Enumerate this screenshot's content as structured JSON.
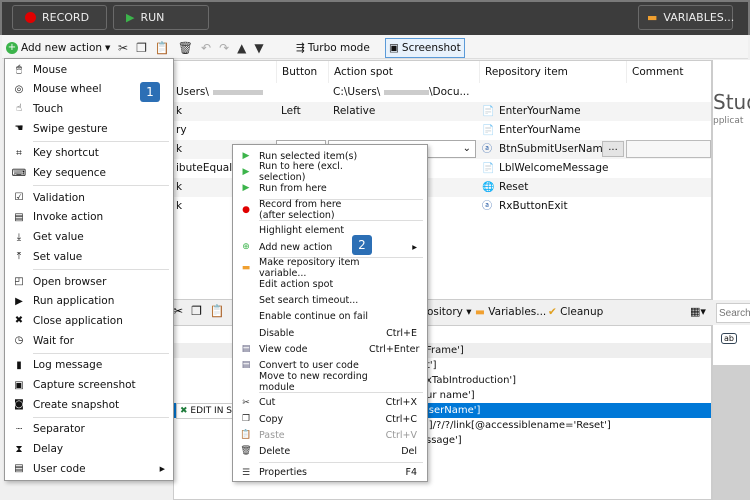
{
  "topbar": {
    "record": "RECORD",
    "run": "RUN",
    "variables": "VARIABLES..."
  },
  "toolbar": {
    "add_new_action": "Add new action",
    "turbo_mode": "Turbo mode",
    "screenshot": "Screenshot"
  },
  "grid": {
    "headers": [
      "",
      "Button",
      "Action spot",
      "Repository item",
      "Comment"
    ],
    "rows": [
      {
        "c0": "Users\\",
        "button": "",
        "spot": "C:\\Users\\",
        "spot2": "\\Docu...",
        "repo": "",
        "icon": ""
      },
      {
        "c0": "k",
        "button": "Left",
        "spot": "Relative",
        "repo": "EnterYourName",
        "icon": "doc"
      },
      {
        "c0": "ry",
        "button": "",
        "spot": "",
        "repo": "EnterYourName",
        "icon": "doc"
      },
      {
        "c0": "k",
        "button": "",
        "spot": "",
        "repo": "BtnSubmitUserName",
        "icon": "ab"
      },
      {
        "c0": "ibuteEqual",
        "button": "",
        "spot": "",
        "repo": "LblWelcomeMessage",
        "icon": "doc"
      },
      {
        "c0": "k",
        "button": "",
        "spot": "",
        "repo": "Reset",
        "icon": "globe"
      },
      {
        "c0": "k",
        "button": "",
        "spot": "",
        "repo": "RxButtonExit",
        "icon": "ab"
      }
    ],
    "browse": "..."
  },
  "side_panel": {
    "title": "Stud",
    "subtitle": "pplicat"
  },
  "bottom_toolbar": {
    "repository": "ository",
    "variables": "Variables...",
    "cleanup": "Cleanup",
    "search_placeholder": "Search"
  },
  "bottom_grid": {
    "edit_button": "EDIT IN S",
    "rows": [
      "Frame']",
      "t']",
      "xTabIntroduction']",
      "ur name']",
      "lserName']",
      "']/?/?/link[@accessiblename='Reset']",
      "ssage']"
    ],
    "selected_index": 4
  },
  "add_menu": {
    "badge": "1",
    "groups": [
      [
        "Mouse",
        "Mouse wheel",
        "Touch",
        "Swipe gesture"
      ],
      [
        "Key shortcut",
        "Key sequence"
      ],
      [
        "Validation",
        "Invoke action",
        "Get value",
        "Set value"
      ],
      [
        "Open browser",
        "Run application",
        "Close application",
        "Wait for"
      ],
      [
        "Log message",
        "Capture screenshot",
        "Create snapshot"
      ],
      [
        "Separator",
        "Delay",
        "User code"
      ]
    ]
  },
  "context_menu": {
    "badge": "2",
    "items": [
      {
        "label": "Run selected item(s)",
        "shortcut": "",
        "icon": "run"
      },
      {
        "label": "Run to here (excl. selection)",
        "shortcut": "",
        "icon": "run"
      },
      {
        "label": "Run from here",
        "shortcut": "",
        "icon": "run"
      },
      {
        "sep": true
      },
      {
        "label": "Record from here (after selection)",
        "shortcut": "",
        "icon": "record"
      },
      {
        "sep": true
      },
      {
        "label": "Highlight element",
        "shortcut": "",
        "icon": ""
      },
      {
        "label": "Add new action",
        "shortcut": "",
        "icon": "add",
        "submenu": true
      },
      {
        "sep": true
      },
      {
        "label": "Make repository item variable...",
        "shortcut": "",
        "icon": "var"
      },
      {
        "label": "Edit action spot",
        "shortcut": "",
        "icon": ""
      },
      {
        "label": "Set search timeout...",
        "shortcut": "",
        "icon": ""
      },
      {
        "label": "Enable continue on fail",
        "shortcut": "",
        "icon": ""
      },
      {
        "label": "Disable",
        "shortcut": "Ctrl+E",
        "icon": ""
      },
      {
        "label": "View code",
        "shortcut": "Ctrl+Enter",
        "icon": "code"
      },
      {
        "label": "Convert to user code",
        "shortcut": "",
        "icon": "code"
      },
      {
        "label": "Move to new recording module",
        "shortcut": "",
        "icon": ""
      },
      {
        "sep": true
      },
      {
        "label": "Cut",
        "shortcut": "Ctrl+X",
        "icon": "cut"
      },
      {
        "label": "Copy",
        "shortcut": "Ctrl+C",
        "icon": "copy"
      },
      {
        "label": "Paste",
        "shortcut": "Ctrl+V",
        "icon": "paste",
        "disabled": true
      },
      {
        "label": "Delete",
        "shortcut": "Del",
        "icon": "delete"
      },
      {
        "sep": true
      },
      {
        "label": "Properties",
        "shortcut": "F4",
        "icon": "props"
      }
    ]
  },
  "colors": {
    "selection": "#0078d7",
    "badge": "#2c6fb5",
    "record_red": "#e00000",
    "run_green": "#3cb44b"
  }
}
